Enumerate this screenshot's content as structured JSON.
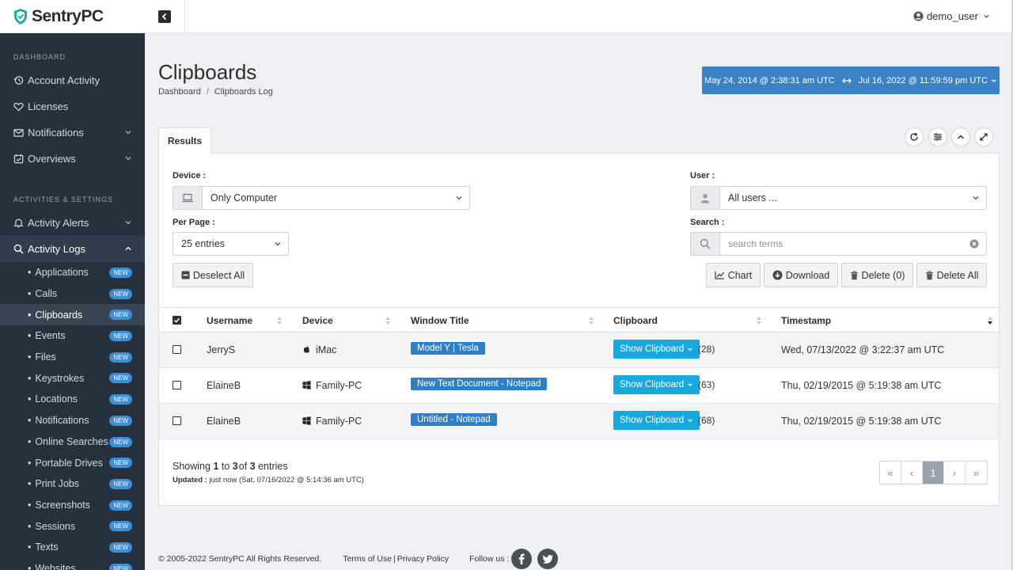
{
  "brand": {
    "name": "SentryPC"
  },
  "topbar": {
    "user": "demo_user"
  },
  "sidebar": {
    "sections": [
      {
        "title": "DASHBOARD"
      },
      {
        "title": "ACTIVITIES & SETTINGS"
      }
    ],
    "dashboard_items": [
      {
        "label": "Account Activity",
        "icon": "history-icon"
      },
      {
        "label": "Licenses",
        "icon": "heart-icon"
      },
      {
        "label": "Notifications",
        "icon": "envelope-icon"
      },
      {
        "label": "Overviews",
        "icon": "calendar-check-icon"
      }
    ],
    "activity_items": [
      {
        "label": "Activity Alerts",
        "icon": "bell-icon"
      },
      {
        "label": "Activity Logs",
        "icon": "search-icon"
      }
    ],
    "sub_items": [
      {
        "label": "Applications",
        "badge": "NEW"
      },
      {
        "label": "Calls",
        "badge": "NEW"
      },
      {
        "label": "Clipboards",
        "badge": "NEW"
      },
      {
        "label": "Events",
        "badge": "NEW"
      },
      {
        "label": "Files",
        "badge": "NEW"
      },
      {
        "label": "Keystrokes",
        "badge": "NEW"
      },
      {
        "label": "Locations",
        "badge": "NEW"
      },
      {
        "label": "Notifications",
        "badge": "NEW"
      },
      {
        "label": "Online Searches",
        "badge": "NEW"
      },
      {
        "label": "Portable Drives",
        "badge": "NEW"
      },
      {
        "label": "Print Jobs",
        "badge": "NEW"
      },
      {
        "label": "Screenshots",
        "badge": "NEW"
      },
      {
        "label": "Sessions",
        "badge": "NEW"
      },
      {
        "label": "Texts",
        "badge": "NEW"
      },
      {
        "label": "Websites",
        "badge": "NEW"
      }
    ]
  },
  "header": {
    "title": "Clipboards",
    "breadcrumb": [
      "Dashboard",
      "Clipboards Log"
    ],
    "date_from": "May 24, 2014 @ 2:38:31 am UTC",
    "date_to": "Jul 16, 2022 @ 11:59:59 pm UTC"
  },
  "tabs": [
    {
      "label": "Results"
    }
  ],
  "filters": {
    "device_label": "Device :",
    "device_value": "Only Computer",
    "user_label": "User :",
    "user_value": "All users ...",
    "per_page_label": "Per Page :",
    "per_page_value": "25 entries",
    "search_label": "Search :",
    "search_placeholder": "search terms"
  },
  "actions": {
    "deselect_all": "Deselect All",
    "chart": "Chart",
    "download": "Download",
    "delete": "Delete (0)",
    "delete_all": "Delete All"
  },
  "table": {
    "columns": [
      "Username",
      "Device",
      "Window Title",
      "Clipboard",
      "Timestamp"
    ],
    "rows": [
      {
        "username": "JerryS",
        "device": "iMac",
        "device_icon": "apple-icon",
        "window_title": "Model Y | Tesla",
        "clipboard_btn": "Show Clipboard",
        "count": "(28)",
        "timestamp": "Wed, 07/13/2022 @ 3:22:37 am UTC"
      },
      {
        "username": "ElaineB",
        "device": "Family-PC",
        "device_icon": "windows-icon",
        "window_title": "New Text Document - Notepad",
        "clipboard_btn": "Show Clipboard",
        "count": "(63)",
        "timestamp": "Thu, 02/19/2015 @ 5:19:38 am UTC"
      },
      {
        "username": "ElaineB",
        "device": "Family-PC",
        "device_icon": "windows-icon",
        "window_title": "Untitled - Notepad",
        "clipboard_btn": "Show Clipboard",
        "count": "(68)",
        "timestamp": "Thu, 02/19/2015 @ 5:19:38 am UTC"
      }
    ]
  },
  "summary": {
    "showing_prefix": "Showing",
    "from": "1",
    "to_word": "to",
    "to": "3",
    "of_word": "of",
    "total": "3",
    "entries_word": "entries",
    "updated_label": "Updated :",
    "updated_value": "just now (Sat, 07/16/2022 @ 5:14:36 am UTC)"
  },
  "pagination": {
    "first": "«",
    "prev": "‹",
    "current": "1",
    "next": "›",
    "last": "»"
  },
  "footer": {
    "copyright": "© 2005-2022 SentryPC All Rights Reserved.",
    "terms": "Terms of Use",
    "divider": "|",
    "privacy": "Privacy Policy",
    "follow": "Follow us :"
  },
  "colors": {
    "sidebar": "#27313e",
    "primary": "#3b82c4",
    "clipboard_btn": "#18a8e0",
    "badge": "#3b8ed8"
  }
}
